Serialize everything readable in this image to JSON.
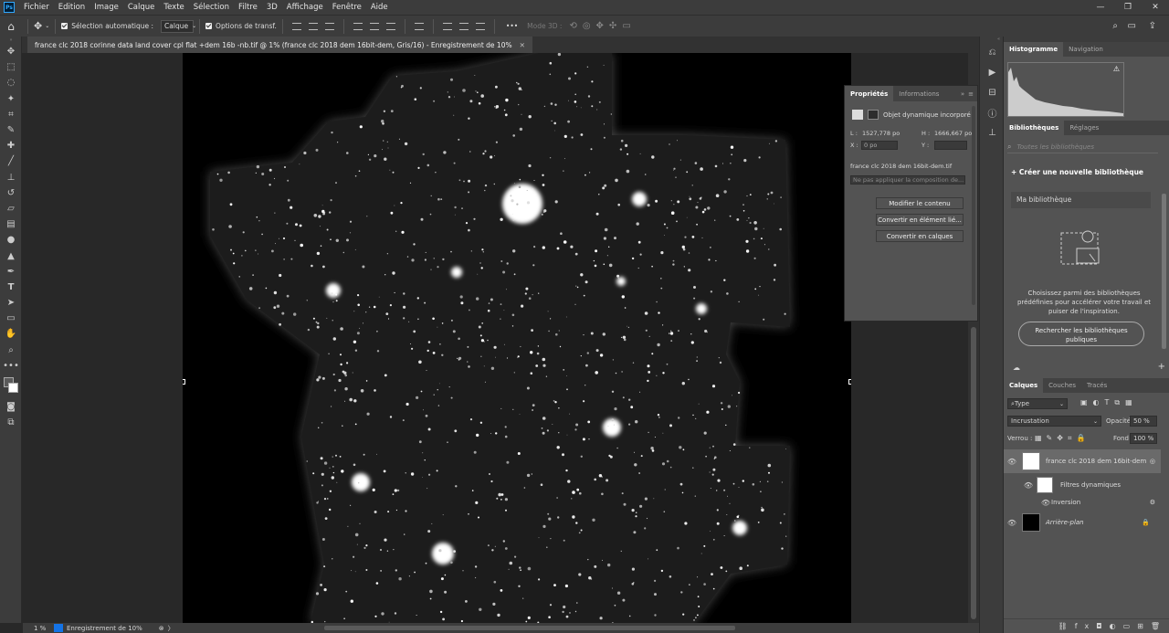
{
  "app": {
    "logo": "Ps"
  },
  "menu": [
    "Fichier",
    "Edition",
    "Image",
    "Calque",
    "Texte",
    "Sélection",
    "Filtre",
    "3D",
    "Affichage",
    "Fenêtre",
    "Aide"
  ],
  "window_controls": {
    "minimize": "—",
    "maximize": "❐",
    "close": "✕"
  },
  "options_bar": {
    "auto_select_label": "Sélection automatique :",
    "auto_select_value": "Calque",
    "transform_label": "Options de transf.",
    "more": "•••",
    "mode3d": "Mode 3D :"
  },
  "document": {
    "tab_title": "france clc 2018 corinne data land cover cpl flat +dem 16b -nb.tif @ 1% (france clc 2018 dem 16bit-dem, Gris/16) - Enregistrement de 10%",
    "close": "✕"
  },
  "status": {
    "zoom": "1 %",
    "message": "Enregistrement de 10%"
  },
  "properties": {
    "tabs": [
      "Propriétés",
      "Informations"
    ],
    "object_type": "Objet dynamique incorporé",
    "w_label": "L :",
    "w_value": "1527,778 po",
    "h_label": "H :",
    "h_value": "1666,667 po",
    "x_label": "X :",
    "x_value": "0 po",
    "y_label": "Y :",
    "y_value": "",
    "filename": "france clc 2018 dem 16bit-dem.tif",
    "composition_placeholder": "Ne pas appliquer la composition de...",
    "btn_edit": "Modifier le contenu",
    "btn_convert_linked": "Convertir en élément lié...",
    "btn_convert_layers": "Convertir en calques"
  },
  "histogram_panel": {
    "tabs": [
      "Histogramme",
      "Navigation"
    ],
    "warning": "⚠"
  },
  "libraries_panel": {
    "tabs": [
      "Bibliothèques",
      "Réglages"
    ],
    "search_placeholder": "Toutes les bibliothèques",
    "create": "Créer une nouvelle bibliothèque",
    "my_library": "Ma bibliothèque",
    "info": "Choisissez parmi des bibliothèques prédéfinies pour accélérer votre travail et puiser de l'inspiration.",
    "search_button": "Rechercher les bibliothèques publiques"
  },
  "layers_panel": {
    "tabs": [
      "Calques",
      "Couches",
      "Tracés"
    ],
    "filter": "Type",
    "blend_mode": "Incrustation",
    "opacity_label": "Opacité :",
    "opacity_value": "50 %",
    "lock_label": "Verrou :",
    "fill_label": "Fond :",
    "fill_value": "100 %",
    "layers": [
      {
        "name": "france clc 2018 dem 16bit-dem"
      },
      {
        "name": "Filtres dynamiques"
      },
      {
        "name": "Inversion"
      },
      {
        "name": "Arrière-plan"
      }
    ]
  },
  "colors": {
    "accent": "#1473e6",
    "panel": "#535353",
    "bar": "#3c3c3c"
  }
}
